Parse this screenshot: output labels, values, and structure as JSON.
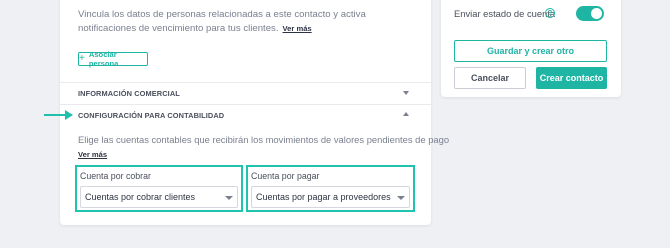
{
  "contacts": {
    "description": "Vincula los datos de personas relacionadas a este contacto y activa notificaciones de vencimiento para tus clientes.",
    "more_link": "Ver más",
    "associate_button": "Asociar persona",
    "associate_icon": "plus-icon"
  },
  "sections": {
    "commercial": {
      "title": "INFORMACIÓN COMERCIAL",
      "expanded": false
    },
    "accounting": {
      "title": "CONFIGURACIÓN PARA CONTABILIDAD",
      "expanded": true,
      "description": "Elige las cuentas contables que recibirán los movimientos de valores pendientes de pago",
      "more_link": "Ver más",
      "receivable": {
        "label": "Cuenta por cobrar",
        "value": "Cuentas por cobrar clientes"
      },
      "payable": {
        "label": "Cuenta por pagar",
        "value": "Cuentas por pagar a proveedores"
      }
    }
  },
  "sidebar": {
    "send_statement_label": "Enviar estado de cuenta",
    "send_statement_enabled": true,
    "help_icon": "question-circle-icon",
    "save_and_new": "Guardar y crear otro",
    "cancel": "Cancelar",
    "create": "Crear contacto"
  },
  "colors": {
    "accent": "#1fb5a4",
    "highlight": "#20c4ae",
    "background": "#eef0f4"
  }
}
